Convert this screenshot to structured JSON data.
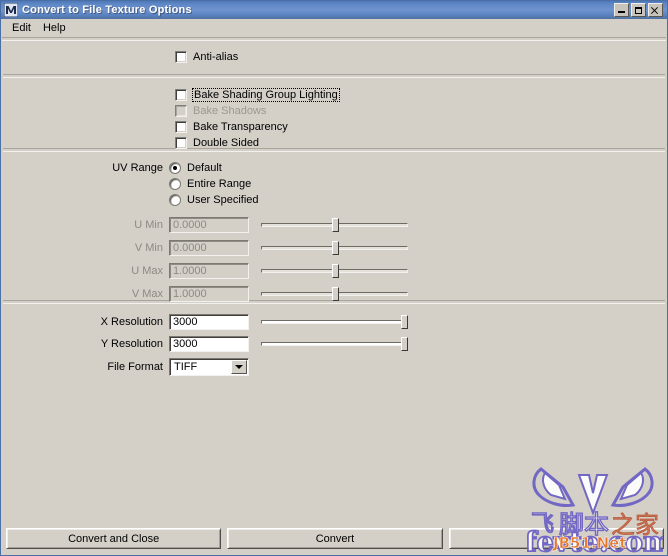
{
  "window": {
    "title": "Convert to File Texture Options",
    "icon": "maya-m-icon",
    "title_buttons": [
      {
        "name": "minimize-button",
        "glyph": "minimize-icon"
      },
      {
        "name": "maximize-button",
        "glyph": "maximize-icon"
      },
      {
        "name": "close-button",
        "glyph": "close-icon"
      }
    ],
    "accent_color": "#5f88c6",
    "background_color": "#d4d0c8"
  },
  "menubar": {
    "items": [
      {
        "label": "Edit"
      },
      {
        "label": "Help"
      }
    ]
  },
  "sections": {
    "antialias": {
      "checkbox": {
        "label": "Anti-alias",
        "checked": false,
        "enabled": true,
        "focused": false
      }
    },
    "bake": {
      "checkboxes": [
        {
          "label": "Bake Shading Group Lighting",
          "checked": false,
          "enabled": true,
          "focused": true
        },
        {
          "label": "Bake Shadows",
          "checked": false,
          "enabled": false,
          "focused": false
        },
        {
          "label": "Bake Transparency",
          "checked": false,
          "enabled": true,
          "focused": false
        },
        {
          "label": "Double Sided",
          "checked": false,
          "enabled": true,
          "focused": false
        }
      ]
    },
    "uv_range": {
      "label": "UV Range",
      "options": [
        {
          "label": "Default",
          "selected": true
        },
        {
          "label": "Entire Range",
          "selected": false
        },
        {
          "label": "User Specified",
          "selected": false
        }
      ],
      "fields": [
        {
          "label": "U Min",
          "value": "0.0000",
          "enabled": false,
          "slider_percent": 48
        },
        {
          "label": "V Min",
          "value": "0.0000",
          "enabled": false,
          "slider_percent": 48
        },
        {
          "label": "U Max",
          "value": "1.0000",
          "enabled": false,
          "slider_percent": 48
        },
        {
          "label": "V Max",
          "value": "1.0000",
          "enabled": false,
          "slider_percent": 48
        }
      ]
    },
    "output": {
      "resolution_fields": [
        {
          "label": "X Resolution",
          "value": "3000",
          "enabled": true,
          "slider_percent": 99
        },
        {
          "label": "Y Resolution",
          "value": "3000",
          "enabled": true,
          "slider_percent": 99
        }
      ],
      "file_format": {
        "label": "File Format",
        "value": "TIFF"
      }
    }
  },
  "buttons": [
    {
      "label": "Convert and Close"
    },
    {
      "label": "Convert"
    },
    {
      "label": ""
    }
  ],
  "watermark": {
    "chinese_prefix": "飞",
    "chinese_main": "脚本",
    "chinese_suffix": "之家",
    "badge": "JB51.Net",
    "site": "fevte.com",
    "logo": "winged-v-logo"
  }
}
